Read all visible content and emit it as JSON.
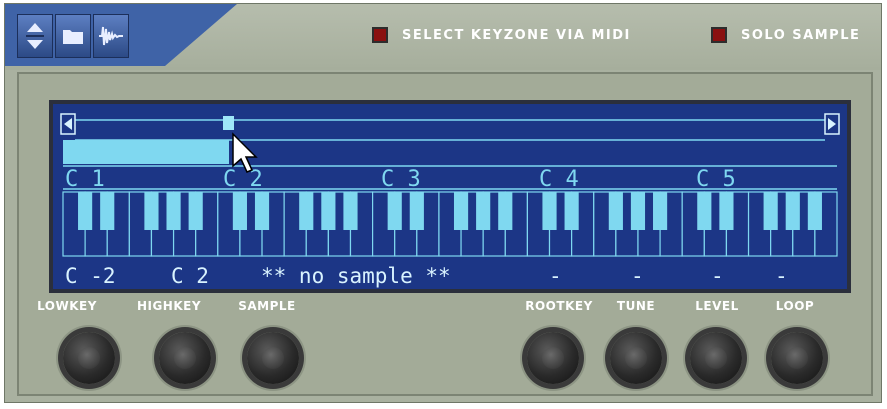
{
  "toolbar": {
    "patch_buttons": [
      {
        "name": "patch-browse-up-down-button",
        "icon": "up-down-arrows-icon"
      },
      {
        "name": "browse-folder-button",
        "icon": "folder-icon"
      },
      {
        "name": "waveform-button",
        "icon": "waveform-icon"
      }
    ],
    "select_keyzone_label": "SELECT KEYZONE VIA MIDI",
    "solo_sample_label": "SOLO SAMPLE",
    "led_color": "#8a1010"
  },
  "display": {
    "background_color": "#1c3686",
    "accent_color": "#7fd8f0",
    "octave_labels": [
      "C 1",
      "C 2",
      "C 3",
      "C 4",
      "C 5"
    ],
    "scroll_left_icon": "triangle-left-icon",
    "scroll_right_icon": "triangle-right-icon",
    "params": {
      "lowkey": "C -2",
      "highkey": "C 2",
      "sample": "** no sample **",
      "rootkey": "-",
      "tune": "-",
      "level": "-",
      "loop": "-"
    }
  },
  "knobs": [
    {
      "id": "lowkey",
      "label": "LOWKEY"
    },
    {
      "id": "highkey",
      "label": "HIGHKEY"
    },
    {
      "id": "sample",
      "label": "SAMPLE"
    },
    {
      "id": "rootkey",
      "label": "ROOTKEY"
    },
    {
      "id": "tune",
      "label": "TUNE"
    },
    {
      "id": "level",
      "label": "LEVEL"
    },
    {
      "id": "loop",
      "label": "LOOP"
    }
  ]
}
